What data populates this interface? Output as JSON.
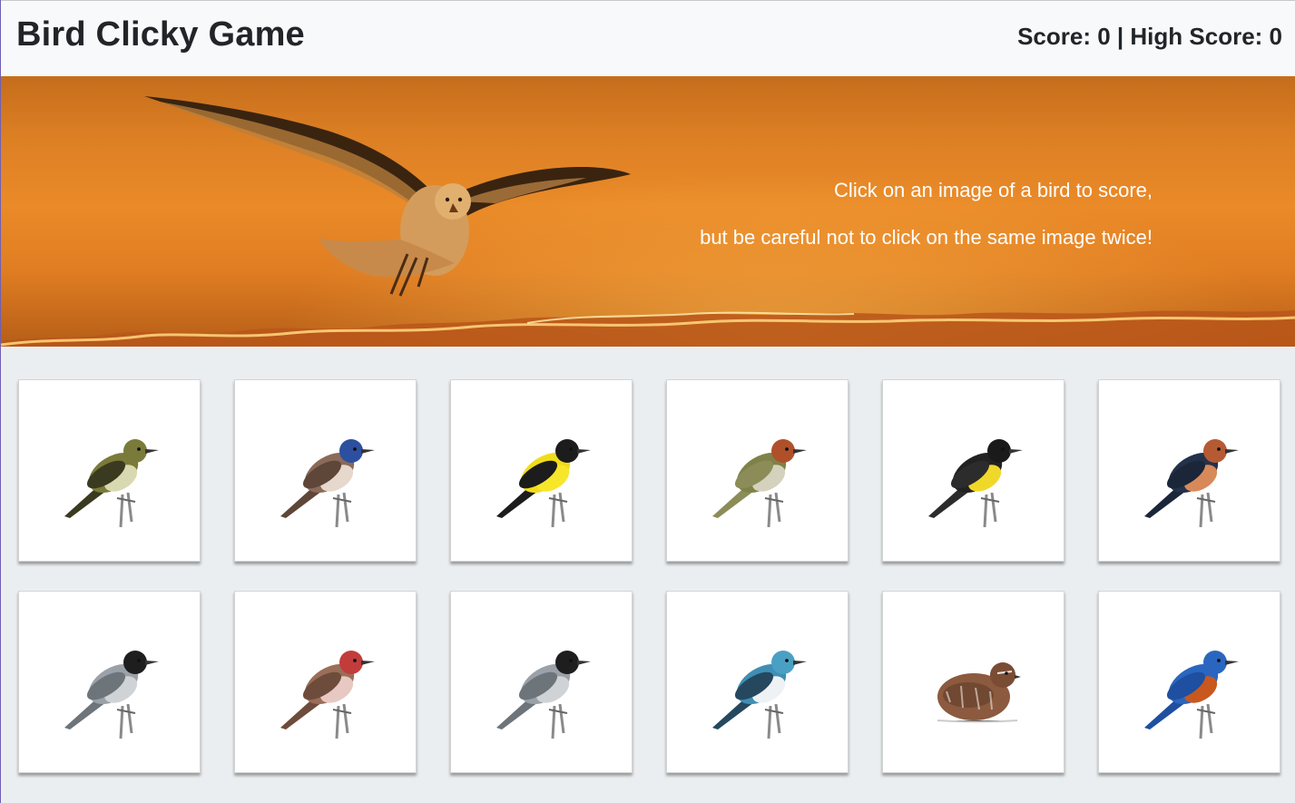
{
  "navbar": {
    "brand": "Bird Clicky Game",
    "score_text": "Score: 0 | High Score: 0"
  },
  "hero": {
    "line1": "Click on an image of a bird to score,",
    "line2": "but be careful not to click on the same image twice!",
    "image": "seagull-sunset"
  },
  "birds": [
    {
      "name": "eastern-wood-pewee",
      "body": "#7a7a3a",
      "wing": "#3a3a20",
      "belly": "#d8d9b0",
      "head": "#7a7a3a"
    },
    {
      "name": "bluethroat",
      "body": "#8a6a58",
      "wing": "#5e4638",
      "belly": "#e6d8cc",
      "head": "#2c4fa0"
    },
    {
      "name": "american-goldfinch",
      "body": "#f1dc1a",
      "wing": "#1c1c1c",
      "belly": "#f7e62a",
      "head": "#1c1c1c"
    },
    {
      "name": "rufous-capped-sparrow",
      "body": "#7f8248",
      "wing": "#8c8c58",
      "belly": "#d4d2bc",
      "head": "#b0502a"
    },
    {
      "name": "bananaquit",
      "body": "#222222",
      "wing": "#2c2c2c",
      "belly": "#f0d82a",
      "head": "#1a1a1a"
    },
    {
      "name": "barn-swallow",
      "body": "#23324a",
      "wing": "#1b2638",
      "belly": "#d8895a",
      "head": "#b65a34"
    },
    {
      "name": "blackcap",
      "body": "#9aa1a8",
      "wing": "#6d747a",
      "belly": "#cfd3d6",
      "head": "#1e1e1e"
    },
    {
      "name": "common-rosefinch",
      "body": "#9a6e58",
      "wing": "#6e4c3c",
      "belly": "#e8c8c2",
      "head": "#c23c3c"
    },
    {
      "name": "blackcap-2",
      "body": "#9aa1a8",
      "wing": "#6d747a",
      "belly": "#cfd3d6",
      "head": "#1e1e1e"
    },
    {
      "name": "cerulean-warbler",
      "body": "#3f8fb4",
      "wing": "#25485e",
      "belly": "#eef2f4",
      "head": "#4aa0c4"
    },
    {
      "name": "bobwhite-quail",
      "body": "#8c5a3e",
      "wing": "#6a4430",
      "belly": "#b28066",
      "head": "#7a4c34"
    },
    {
      "name": "eastern-bluebird",
      "body": "#2a66c0",
      "wing": "#1f4fa0",
      "belly": "#c8581e",
      "head": "#2a66c0"
    }
  ]
}
